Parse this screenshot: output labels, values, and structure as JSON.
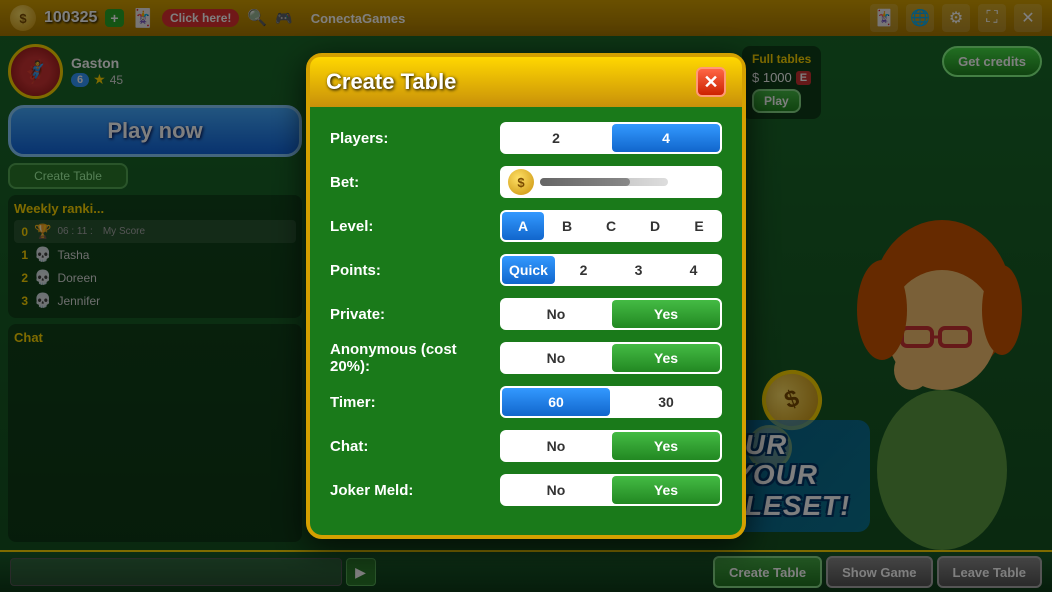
{
  "topbar": {
    "credits": "100325",
    "plus_label": "+",
    "click_label": "Click here!",
    "logo": "ConectaGames",
    "icons": [
      "cards-icon",
      "globe-icon",
      "settings-icon",
      "fullscreen-icon",
      "close-icon"
    ]
  },
  "left_panel": {
    "player": {
      "name": "Gaston",
      "level": "6",
      "score": "45"
    },
    "play_now": "Play now",
    "create_table_small": "Create Table",
    "weekly_ranking": {
      "title": "Weekly ranki...",
      "time": "06 : 11 :",
      "my_score": "My Score",
      "players": [
        {
          "rank": "1",
          "name": "Tasha"
        },
        {
          "rank": "2",
          "name": "Doreen"
        },
        {
          "rank": "3",
          "name": "Jennifer"
        }
      ]
    },
    "chat": "Chat"
  },
  "right_panel": {
    "get_credits": "Get credits",
    "full_tables": "Full tables",
    "table_amount": "$ 1000"
  },
  "promo": {
    "line1": "CREATE YOUR",
    "line2": "TABLE WITH YOUR",
    "line3": "PREFERRED RULESET!"
  },
  "bottom_bar": {
    "create_table": "Create Table",
    "show_game": "Show Game",
    "leave_table": "Leave Table"
  },
  "modal": {
    "title": "Create Table",
    "close": "✕",
    "rows": [
      {
        "label": "Players:",
        "type": "toggle",
        "options": [
          "2",
          "4"
        ],
        "active": 1
      },
      {
        "label": "Bet:",
        "type": "bet",
        "value": "500"
      },
      {
        "label": "Level:",
        "type": "toggle",
        "options": [
          "A",
          "B",
          "C",
          "D",
          "E"
        ],
        "active": 0
      },
      {
        "label": "Points:",
        "type": "toggle",
        "options": [
          "Quick",
          "2",
          "3",
          "4"
        ],
        "active": 0
      },
      {
        "label": "Private:",
        "type": "toggle2",
        "options": [
          "No",
          "Yes"
        ],
        "active": 1
      },
      {
        "label": "Anonymous (cost 20%):",
        "type": "toggle2",
        "options": [
          "No",
          "Yes"
        ],
        "active": 1
      },
      {
        "label": "Timer:",
        "type": "toggle",
        "options": [
          "60",
          "30"
        ],
        "active": 0
      },
      {
        "label": "Chat:",
        "type": "toggle2",
        "options": [
          "No",
          "Yes"
        ],
        "active": 1
      },
      {
        "label": "Joker Meld:",
        "type": "toggle2",
        "options": [
          "No",
          "Yes"
        ],
        "active": 1
      }
    ]
  }
}
